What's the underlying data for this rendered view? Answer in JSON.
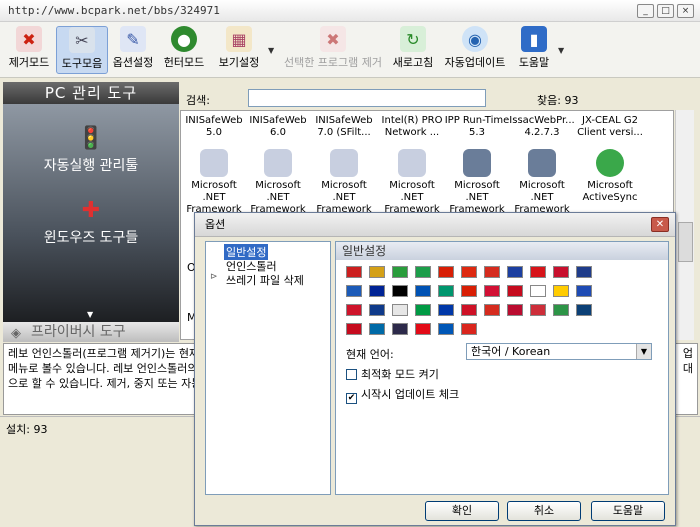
{
  "window": {
    "title": "http://www.bcpark.net/bbs/324971"
  },
  "toolbar": {
    "items": [
      {
        "label": "제거모드",
        "icon": "uninstall-icon"
      },
      {
        "label": "도구모음",
        "icon": "tools-icon"
      },
      {
        "label": "옵션설정",
        "icon": "options-icon"
      },
      {
        "label": "헌터모드",
        "icon": "hunter-icon"
      },
      {
        "label": "보기설정",
        "icon": "view-icon"
      },
      {
        "label": "선택한 프로그램 제거",
        "icon": "remove-selected-icon"
      },
      {
        "label": "새로고침",
        "icon": "refresh-icon"
      },
      {
        "label": "자동업데이트",
        "icon": "update-icon"
      },
      {
        "label": "도움말",
        "icon": "help-icon"
      }
    ]
  },
  "sidebar": {
    "header": "PC 관리 도구",
    "items": [
      {
        "label": "자동실행 관리툴",
        "icon": "traffic-light-icon"
      },
      {
        "label": "윈도우즈 도구들",
        "icon": "swiss-knife-icon"
      }
    ],
    "footer": "프라이버시 도구"
  },
  "search": {
    "label": "검색:",
    "value": "",
    "found_label": "찾음: 93"
  },
  "programs": [
    {
      "name": "INISafeWeb\n5.0"
    },
    {
      "name": "INISafeWeb\n6.0"
    },
    {
      "name": "INISafeWeb\n7.0 (SFilt..."
    },
    {
      "name": "Intel(R) PRO\nNetwork ..."
    },
    {
      "name": "IPP Run-Time\n5.3"
    },
    {
      "name": "IssacWebPr...\n4.2.7.3"
    },
    {
      "name": "JX-CEAL G2\nClient versi..."
    },
    {
      "name": "Microsoft .NET\nFramework ..."
    },
    {
      "name": "Microsoft .NET\nFramework ..."
    },
    {
      "name": "Microsoft .NET\nFramework ..."
    },
    {
      "name": "Microsoft .NET\nFramework ..."
    },
    {
      "name": "Microsoft .NET\nFramework ..."
    },
    {
      "name": "Microsoft .NET\nFramework ..."
    },
    {
      "name": "Microsoft\nActiveSync"
    }
  ],
  "partial_letters": {
    "o": "O",
    "m": "M"
  },
  "description": "레보 언인스톨러(프로그램 제거기)는 현재\n메뉴로 볼수 있습니다. 레보 언인스톨러의\n으로 할 수 있습니다. 제거, 중지 또는 자동",
  "description_right": "업\n대",
  "status": {
    "installed": "설치: 93"
  },
  "dialog": {
    "title": "옵션",
    "tree": [
      {
        "label": "일반설정",
        "selected": true
      },
      {
        "label": "언인스톨러",
        "selected": false
      },
      {
        "label": "쓰레기 파일 삭제",
        "selected": false
      }
    ],
    "panel_title": "일반설정",
    "flag_colors": [
      "#cc1f1f",
      "#d4a017",
      "#2a9d3c",
      "#1c9e4a",
      "#d81e05",
      "#de2910",
      "#d52b1e",
      "#1c3fa0",
      "#d7141a",
      "#c8102e",
      "#1f3c8a",
      "#1c5bb8",
      "#002395",
      "#000000",
      "#0052b4",
      "#00966e",
      "#d81e05",
      "#d21034",
      "#c60b1e",
      "#ffffff",
      "#ffcc00",
      "#1e4bb4",
      "#cf142b",
      "#0f3a8a",
      "#e6e6e6",
      "#009a44",
      "#0038a8",
      "#ce1126",
      "#d52b1e",
      "#ba0c2f",
      "#cd2e3a",
      "#2d9447",
      "#0c4076",
      "#c60b1e",
      "#006aa7",
      "#2d2a4a",
      "#e30a17",
      "#0057b7",
      "#da251d"
    ],
    "language_label": "현재 언어:",
    "language_value": "한국어 / Korean",
    "checkboxes": [
      {
        "label": "최적화 모드 켜기",
        "checked": false
      },
      {
        "label": "시작시 업데이트 체크",
        "checked": true
      }
    ],
    "buttons": {
      "ok": "확인",
      "cancel": "취소",
      "help": "도움말"
    }
  }
}
